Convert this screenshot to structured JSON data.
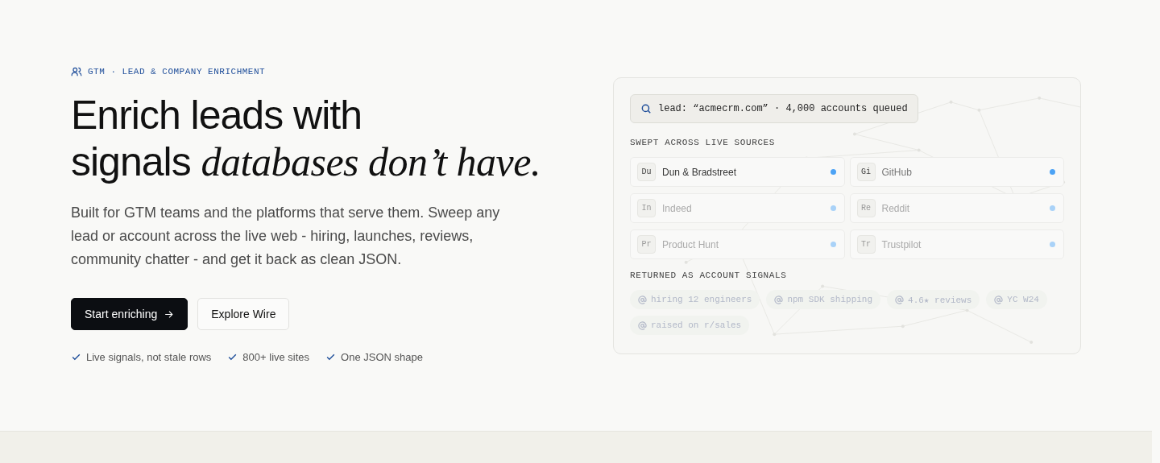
{
  "eyebrow": "GTM · LEAD & COMPANY ENRICHMENT",
  "headline": {
    "line_1": "Enrich leads with",
    "line_2_plain": "signals",
    "line_2_italic": "databases don’t have."
  },
  "intro": "Built for GTM teams and the platforms that serve them. Sweep any lead or account across the live web - hiring, launches, reviews, community chatter - and get it back as clean JSON.",
  "buttons": [
    {
      "label": "Start enriching",
      "kind": "primary"
    },
    {
      "label": "Explore Wire",
      "kind": "secondary"
    }
  ],
  "features": [
    "Live signals, not stale rows",
    "800+ live sites",
    "One JSON shape"
  ],
  "panel": {
    "query": "lead: “acmecrm.com” · 4,000 accounts queued",
    "sources_heading": "SWEPT ACROSS LIVE SOURCES",
    "sources": [
      {
        "abbr": "Du",
        "name": "Dun & Bradstreet",
        "active": true
      },
      {
        "abbr": "Gi",
        "name": "GitHub",
        "active": true
      },
      {
        "abbr": "In",
        "name": "Indeed",
        "active": false
      },
      {
        "abbr": "Re",
        "name": "Reddit",
        "active": false
      },
      {
        "abbr": "Pr",
        "name": "Product Hunt",
        "active": false
      },
      {
        "abbr": "Tr",
        "name": "Trustpilot",
        "active": false
      }
    ],
    "signals_heading": "RETURNED AS ACCOUNT SIGNALS",
    "signals": [
      "hiring 12 engineers",
      "npm SDK shipping",
      "4.6★ reviews",
      "YC W24",
      "raised on r/sales"
    ]
  }
}
